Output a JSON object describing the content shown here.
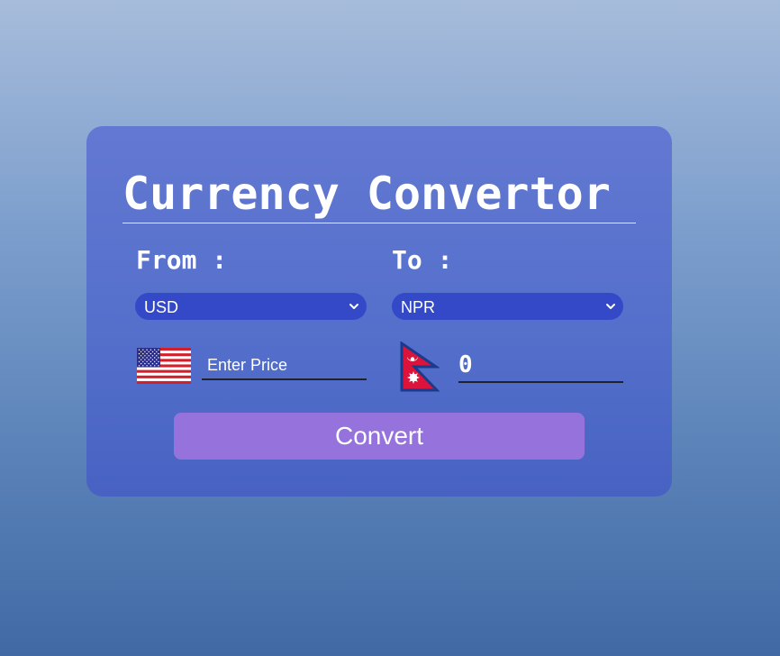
{
  "title": "Currency Convertor",
  "from": {
    "label": "From :",
    "currency": "USD",
    "flag": "us-flag",
    "amount_placeholder": "Enter Price",
    "amount_value": ""
  },
  "to": {
    "label": "To :",
    "currency": "NPR",
    "flag": "nepal-flag",
    "result": "0"
  },
  "convert_label": "Convert",
  "colors": {
    "card_background": "#5a74ce",
    "select_background": "#3449c8",
    "button_background": "#9672dc",
    "text": "#ffffff"
  }
}
